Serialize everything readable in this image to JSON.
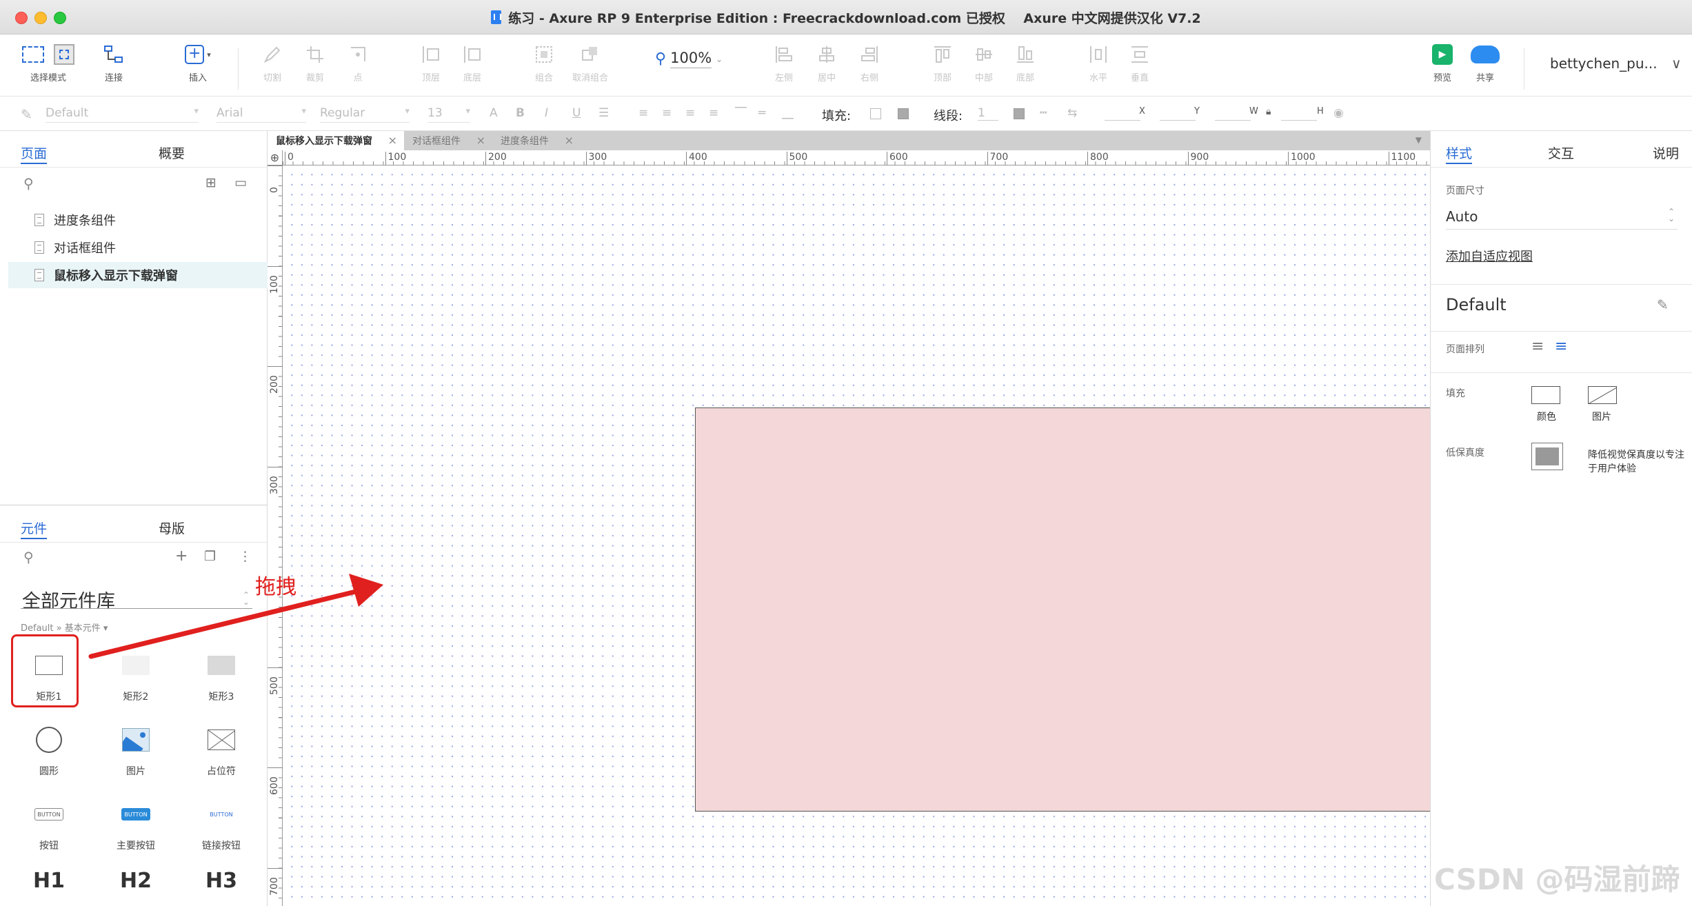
{
  "window": {
    "title": "练习 - Axure RP 9 Enterprise Edition : Freecrackdownload.com 已授权    Axure 中文网提供汉化 V7.2"
  },
  "toolbar": {
    "select_mode": "选择模式",
    "connect": "连接",
    "insert": "插入",
    "cut": "切割",
    "crop": "裁剪",
    "point": "点",
    "top_layer": "顶层",
    "bottom_layer": "底层",
    "group": "组合",
    "ungroup": "取消组合",
    "zoom": "100%",
    "align_left": "左侧",
    "align_center": "居中",
    "align_right": "右侧",
    "align_top": "顶部",
    "align_middle": "中部",
    "align_bottom": "底部",
    "dist_h": "水平",
    "dist_v": "垂直",
    "preview": "预览",
    "share": "共享",
    "user": "bettychen_pu..."
  },
  "format": {
    "style": "Default",
    "font": "Arial",
    "weight": "Regular",
    "size": "13",
    "fill_label": "填充:",
    "stroke_label": "线段:",
    "stroke_value": "1",
    "x": "X",
    "y": "Y",
    "w": "W",
    "h": "H"
  },
  "left": {
    "pages_tab": "页面",
    "outline_tab": "概要",
    "pages": [
      "进度条组件",
      "对话框组件",
      "鼠标移入显示下载弹窗"
    ],
    "widgets_tab": "元件",
    "masters_tab": "母版",
    "library": "全部元件库",
    "library_sub": "Default » 基本元件 ▾",
    "widgets": {
      "rect1": "矩形1",
      "rect2": "矩形2",
      "rect3": "矩形3",
      "circle": "圆形",
      "image": "图片",
      "placeholder": "占位符",
      "button": "按钮",
      "primary_button": "主要按钮",
      "link_button": "链接按钮",
      "btn_text": "BUTTON",
      "h1": "H1",
      "h2": "H2",
      "h3": "H3"
    }
  },
  "canvas": {
    "tabs": [
      "鼠标移入显示下载弹窗",
      "对话框组件",
      "进度条组件"
    ],
    "ruler_x": [
      "0",
      "100",
      "200",
      "300",
      "400",
      "500",
      "600",
      "700",
      "800",
      "900",
      "1000",
      "1100"
    ],
    "ruler_y": [
      "0",
      "100",
      "200",
      "300",
      "500",
      "600",
      "700"
    ],
    "annotation": "拖拽"
  },
  "right": {
    "tab_style": "样式",
    "tab_interact": "交互",
    "tab_notes": "说明",
    "page_size_label": "页面尺寸",
    "page_size_value": "Auto",
    "adaptive_link": "添加自适应视图",
    "style_name": "Default",
    "page_align_label": "页面排列",
    "fill_label": "填充",
    "fill_color": "颜色",
    "fill_image": "图片",
    "lowfi_label": "低保真度",
    "lowfi_desc": "降低视觉保真度以专注于用户体验"
  },
  "watermark": "CSDN @码湿前蹄",
  "colors": {
    "accent": "#2a6bd4",
    "shape_fill": "#f4d7d8",
    "annotation_red": "#e0201e"
  }
}
